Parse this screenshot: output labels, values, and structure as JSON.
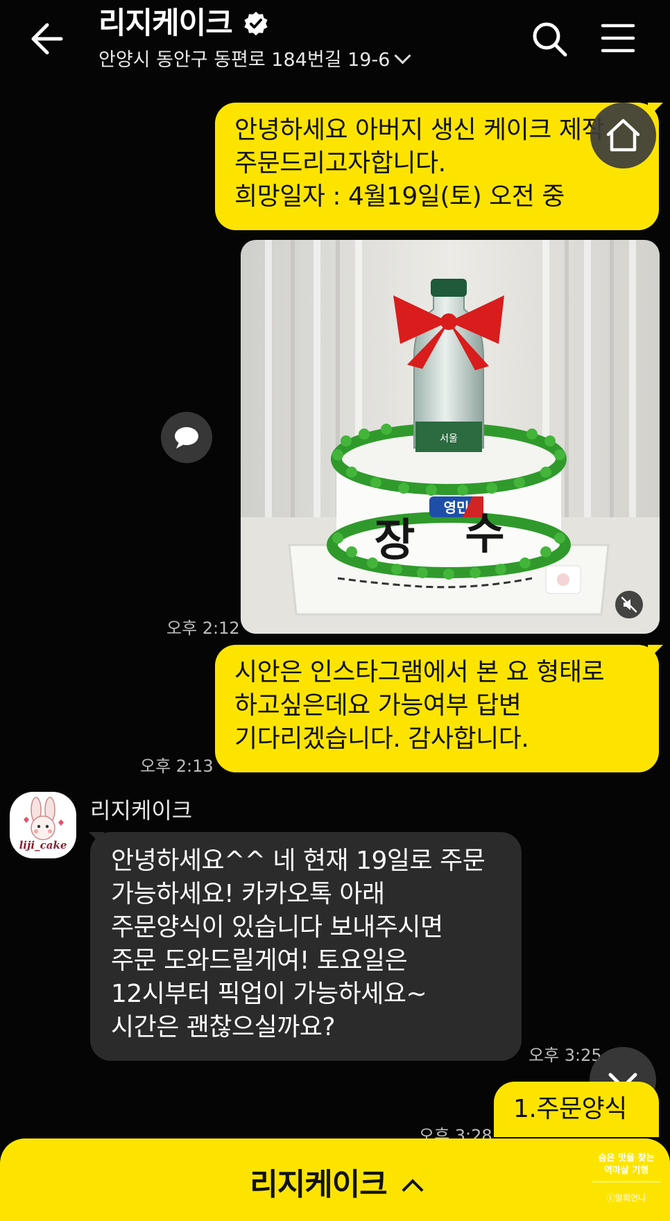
{
  "header": {
    "title": "리지케이크",
    "address": "안양시 동안구 동편로 184번길 19-6"
  },
  "messages": {
    "m1": {
      "lines": [
        "안녕하세요 아버지 생신 케이크 제작",
        "주문드리고자합니다.",
        "희망일자 : 4월19일(토) 오전 중"
      ]
    },
    "photo": {
      "time": "오후 2:12"
    },
    "m2": {
      "lines": [
        "시안은 인스타그램에서 본 요 형태로",
        "하고싶은데요 가능여부 답변",
        "기다리겠습니다. 감사합니다."
      ],
      "time": "오후 2:13"
    },
    "reply": {
      "sender": "리지케이크",
      "avatar_text": "liji_cake",
      "lines": [
        "안녕하세요^^ 네 현재 19일로 주문",
        "가능하세요! 카카오톡 아래",
        "주문양식이 있습니다 보내주시면",
        "주문 도와드릴게여! 토요일은",
        "12시부터 픽업이 가능하세요~",
        "시간은 괜찮으실까요?"
      ],
      "time": "오후 3:25"
    },
    "m3": {
      "text": "1.주문양식",
      "time": "오후 3:28"
    }
  },
  "cake": {
    "bottle_label": "서울",
    "brand": "영민",
    "text_left": "장",
    "text_right": "수"
  },
  "bottom_bar": {
    "label": "리지케이크"
  },
  "watermark": {
    "line1": "숨은 맛을 찾는",
    "line2": "역마살 기행",
    "line3": "ⓒ알회언니"
  },
  "colors": {
    "accent": "#fde400",
    "background": "#050505",
    "received_bubble": "#2b2b2b"
  },
  "icons": [
    "back-arrow-icon",
    "verified-badge-icon",
    "search-icon",
    "menu-icon",
    "home-icon",
    "chat-bubble-icon",
    "mute-icon",
    "chevron-down-icon",
    "caret-up-icon"
  ]
}
